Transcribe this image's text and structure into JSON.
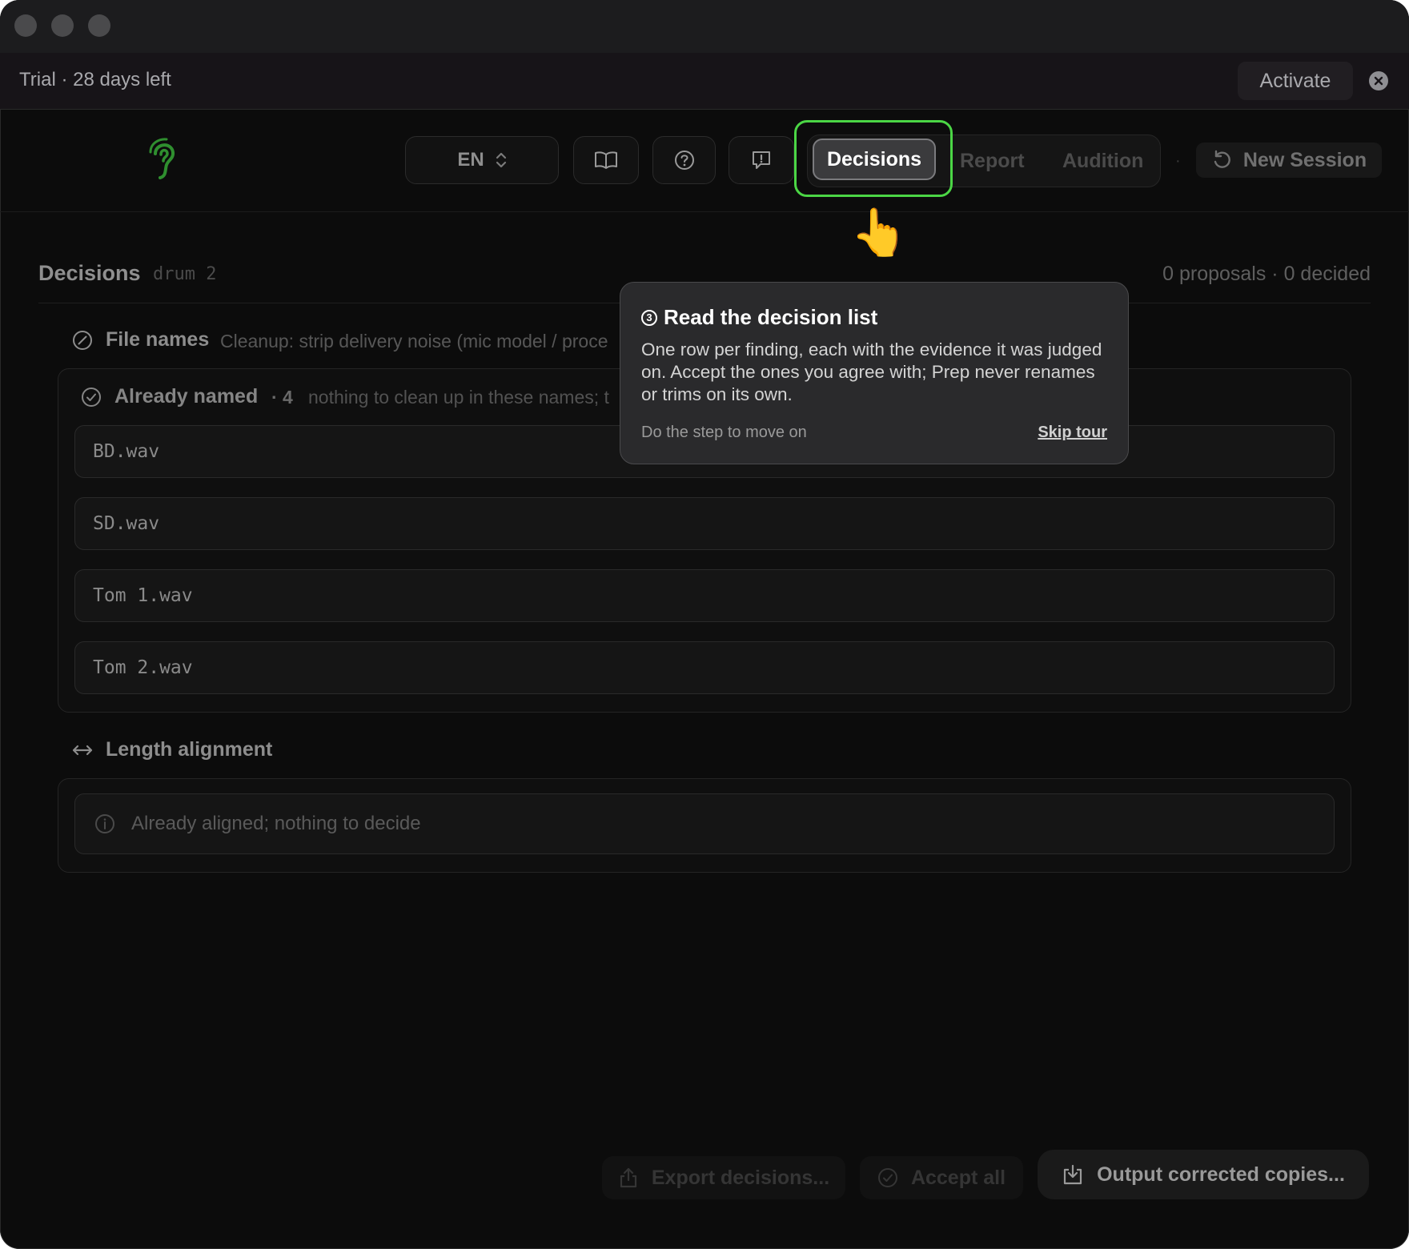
{
  "trial": {
    "text": "Trial · 28 days left",
    "activate_label": "Activate"
  },
  "toolbar": {
    "language": "EN",
    "tabs": {
      "decisions": "Decisions",
      "report": "Report",
      "audition": "Audition"
    },
    "new_session": "New Session",
    "separator": "·"
  },
  "section": {
    "title": "Decisions",
    "session_name": "drum 2",
    "summary": "0 proposals · 0 decided"
  },
  "file_names": {
    "title": "File names",
    "description": "Cleanup: strip delivery noise (mic model / proce",
    "already_named": {
      "title": "Already named",
      "count": "· 4",
      "description": "nothing to clean up in these names; t",
      "files": [
        "BD.wav",
        "SD.wav",
        "Tom 1.wav",
        "Tom 2.wav"
      ]
    }
  },
  "length_alignment": {
    "title": "Length alignment",
    "message": "Already aligned; nothing to decide"
  },
  "tour": {
    "step": "3",
    "title": "Read the decision list",
    "body": "One row per finding, each with the evidence it was judged on. Accept the ones you agree with; Prep never renames or trims on its own.",
    "hint": "Do the step to move on",
    "skip": "Skip tour",
    "pointer": "👆"
  },
  "footer": {
    "export": "Export decisions...",
    "accept_all": "Accept all",
    "output": "Output corrected copies..."
  },
  "colors": {
    "tour_highlight": "#4bd645",
    "logo": "#2f8f2f"
  }
}
